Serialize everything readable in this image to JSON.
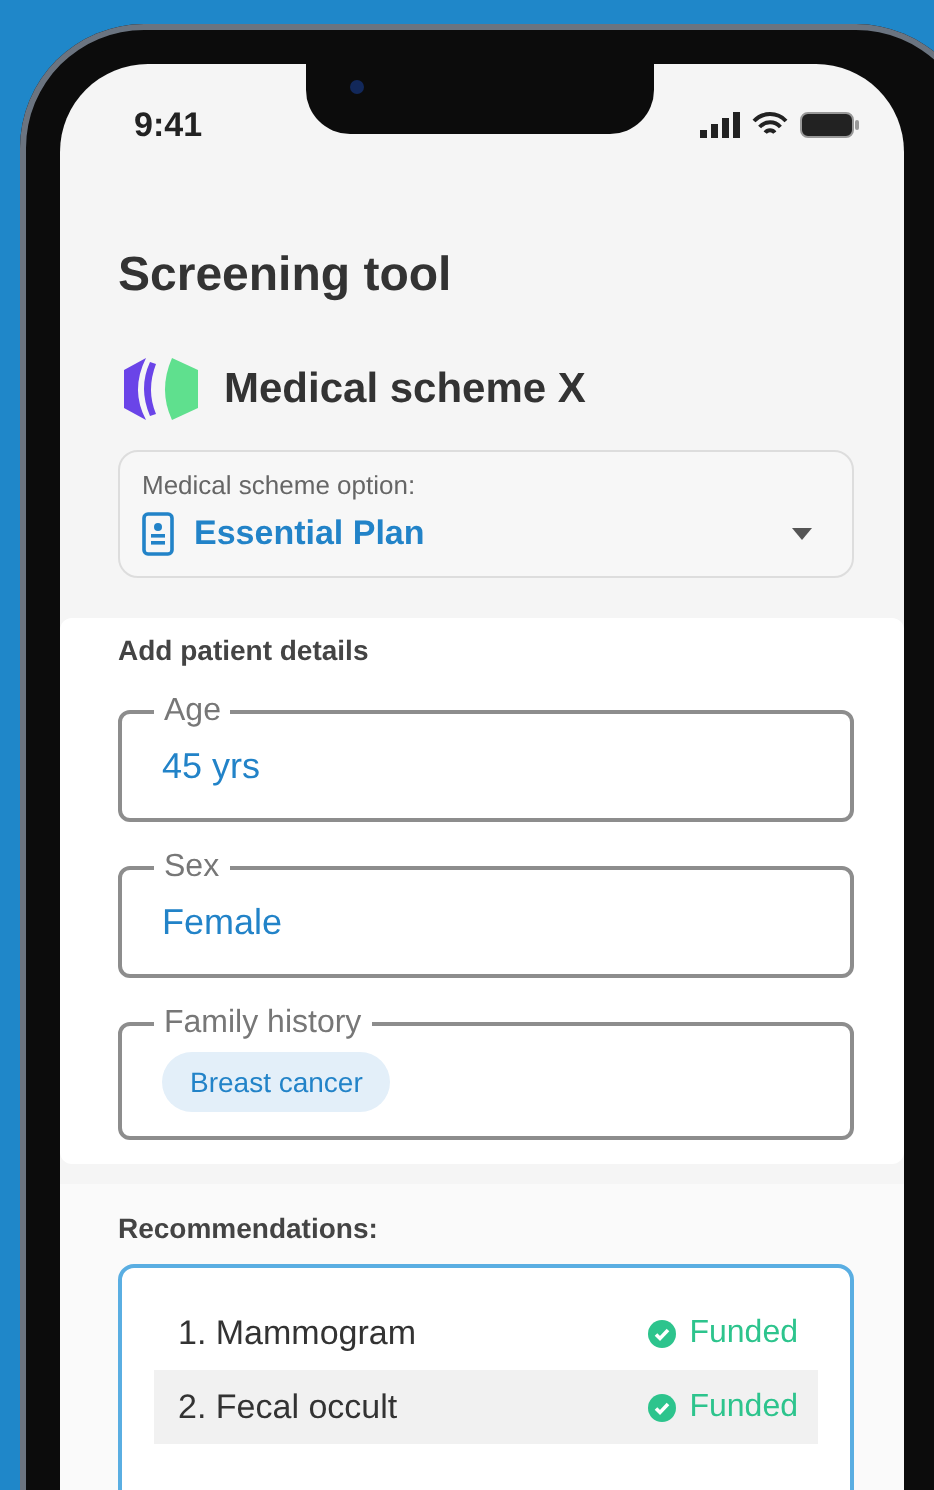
{
  "status_bar": {
    "time": "9:41"
  },
  "title": "Screening tool",
  "scheme": {
    "name": "Medical scheme X"
  },
  "scheme_option": {
    "label": "Medical scheme option:",
    "value": "Essential Plan"
  },
  "patient_details": {
    "heading": "Add patient details",
    "fields": [
      {
        "kind": "text",
        "label": "Age",
        "value": "45 yrs"
      },
      {
        "kind": "text",
        "label": "Sex",
        "value": "Female"
      },
      {
        "kind": "chips",
        "label": "Family history",
        "chips": [
          "Breast cancer"
        ]
      }
    ]
  },
  "recommendations": {
    "heading": "Recommendations:",
    "items": [
      {
        "label": "1. Mammogram",
        "status": "Funded",
        "selected": false
      },
      {
        "label": "2. Fecal occult",
        "status": "Funded",
        "selected": true
      }
    ]
  }
}
